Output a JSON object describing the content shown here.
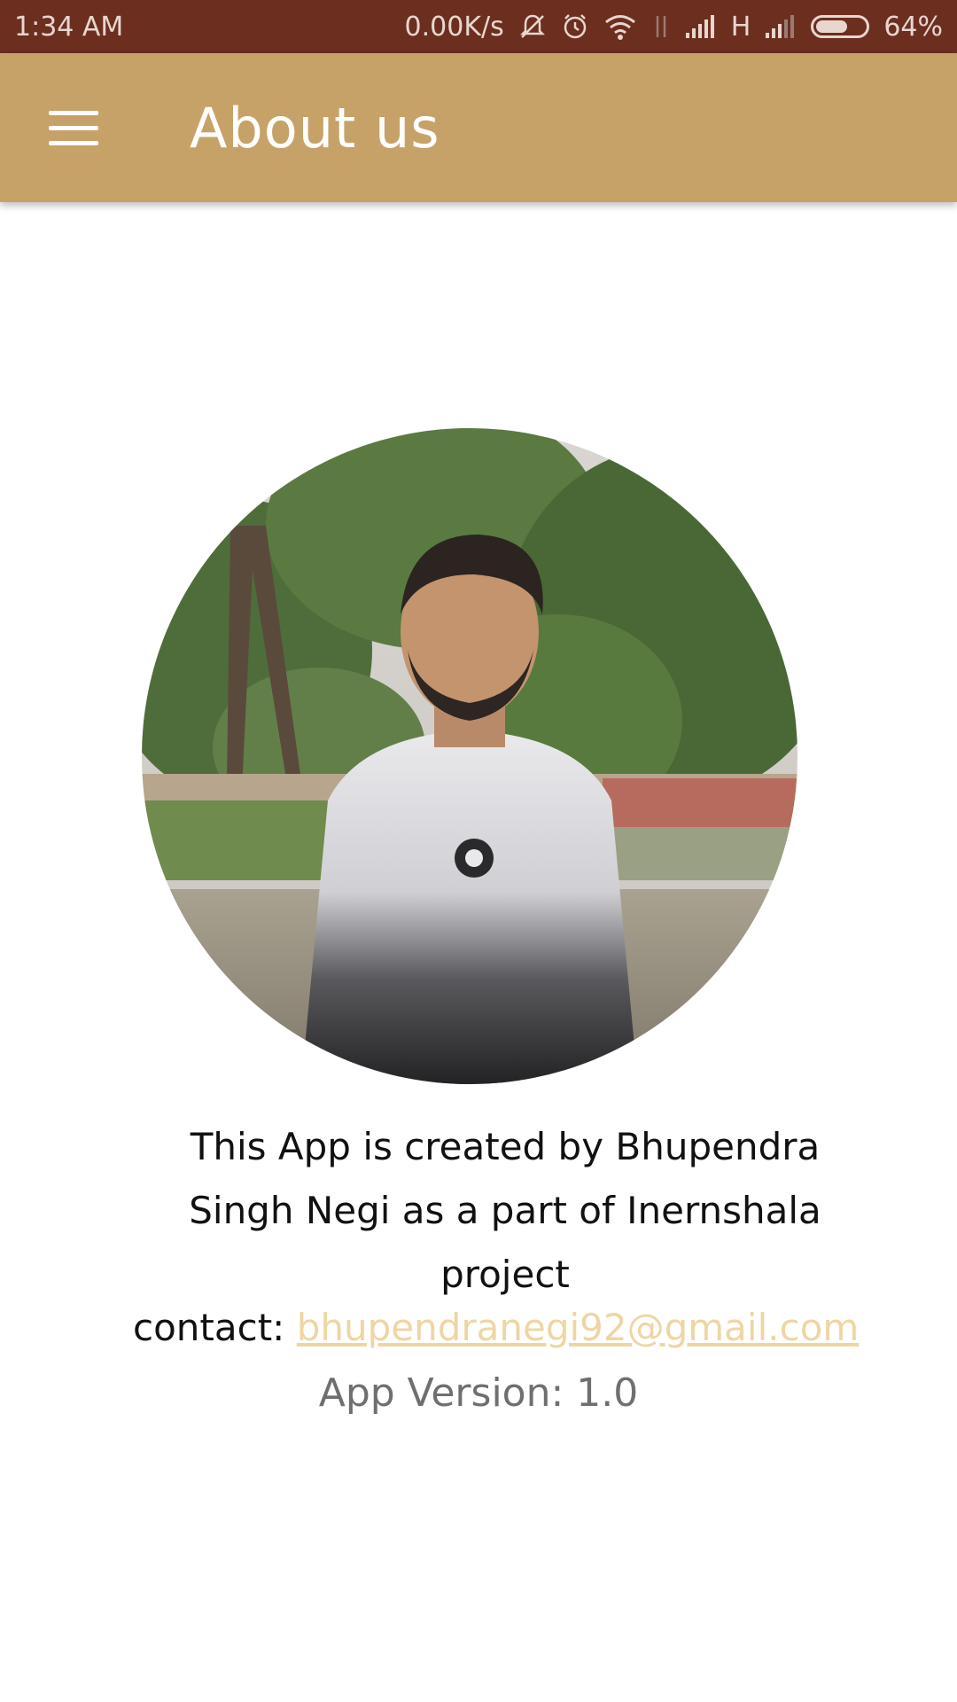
{
  "status_bar": {
    "time": "1:34 AM",
    "network_speed": "0.00K/s",
    "network_type": "H",
    "battery": "64%",
    "battery_level": 0.64,
    "icons": [
      "mute-icon",
      "alarm-icon",
      "wifi-icon",
      "data-transfer-icon",
      "signal-icon",
      "signal-icon-2",
      "battery-icon"
    ]
  },
  "app_bar": {
    "title": "About us",
    "menu_icon": "hamburger-menu-icon",
    "background_color": "#c7a268"
  },
  "profile": {
    "image": "profile-photo"
  },
  "about": {
    "description": "This App is created by Bhupendra Singh Negi as a part of Inernshala project",
    "contact_label": "contact:",
    "contact_email": "bhupendranegi92@gmail.com",
    "version": "App Version: 1.0"
  },
  "colors": {
    "status_bar": "#6b2e1f",
    "accent": "#c7a268",
    "link": "#eed6a3"
  }
}
